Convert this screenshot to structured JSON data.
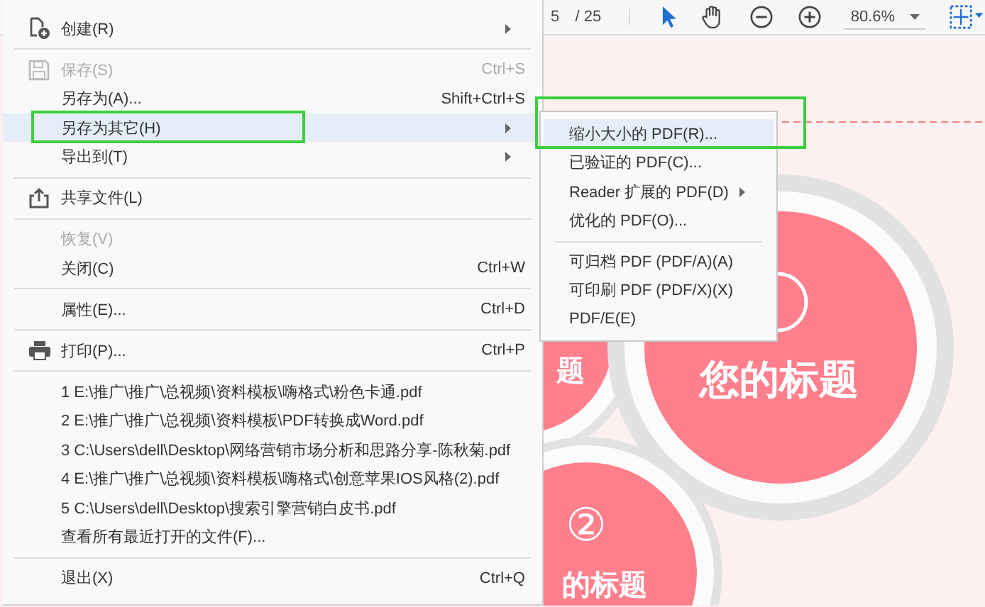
{
  "toolbar": {
    "page": "5",
    "page_count": "/ 25",
    "zoom": "80.6%"
  },
  "document": {
    "texts": [
      {
        "kind": "side_title",
        "text": "题"
      },
      {
        "kind": "main_title",
        "text": "您的标题"
      },
      {
        "kind": "number",
        "text": "②"
      },
      {
        "kind": "bottom_title",
        "text": "的标题"
      }
    ]
  },
  "menu": {
    "items": [
      {
        "kind": "item",
        "label": "创建(R)",
        "has_submenu": true,
        "disabled": false,
        "selected": false
      },
      {
        "kind": "separator"
      },
      {
        "kind": "item",
        "label": "保存(S)",
        "shortcut": "Ctrl+S",
        "has_submenu": false,
        "disabled": true,
        "selected": false
      },
      {
        "kind": "item",
        "label": "另存为(A)...",
        "shortcut": "Shift+Ctrl+S",
        "has_submenu": false,
        "disabled": false,
        "selected": false
      },
      {
        "kind": "item",
        "label": "另存为其它(H)",
        "has_submenu": true,
        "disabled": false,
        "selected": true
      },
      {
        "kind": "item",
        "label": "导出到(T)",
        "has_submenu": true,
        "disabled": false,
        "selected": false
      },
      {
        "kind": "separator"
      },
      {
        "kind": "item",
        "label": "共享文件(L)",
        "has_submenu": false,
        "disabled": false,
        "selected": false
      },
      {
        "kind": "separator"
      },
      {
        "kind": "item",
        "label": "恢复(V)",
        "has_submenu": false,
        "disabled": true,
        "selected": false
      },
      {
        "kind": "item",
        "label": "关闭(C)",
        "shortcut": "Ctrl+W",
        "has_submenu": false,
        "disabled": false,
        "selected": false
      },
      {
        "kind": "separator"
      },
      {
        "kind": "item",
        "label": "属性(E)...",
        "shortcut": "Ctrl+D",
        "has_submenu": false,
        "disabled": false,
        "selected": false
      },
      {
        "kind": "separator"
      },
      {
        "kind": "item",
        "label": "打印(P)...",
        "shortcut": "Ctrl+P",
        "has_submenu": false,
        "disabled": false,
        "selected": false
      },
      {
        "kind": "separator"
      },
      {
        "kind": "recent",
        "label": "1 E:\\推广\\推广\\总视频\\资料模板\\嗨格式\\粉色卡通.pdf",
        "selected": false
      },
      {
        "kind": "recent",
        "label": "2 E:\\推广\\推广\\总视频\\资料模板\\PDF转换成Word.pdf",
        "selected": false
      },
      {
        "kind": "recent",
        "label": "3 C:\\Users\\dell\\Desktop\\网络营销市场分析和思路分享-陈秋菊.pdf",
        "selected": false
      },
      {
        "kind": "recent",
        "label": "4 E:\\推广\\推广\\总视频\\资料模板\\嗨格式\\创意苹果IOS风格(2).pdf",
        "selected": false
      },
      {
        "kind": "recent",
        "label": "5 C:\\Users\\dell\\Desktop\\搜索引擎营销白皮书.pdf",
        "selected": false
      },
      {
        "kind": "recent",
        "label": "查看所有最近打开的文件(F)...",
        "selected": false
      },
      {
        "kind": "separator"
      },
      {
        "kind": "item",
        "label": "退出(X)",
        "shortcut": "Ctrl+Q",
        "has_submenu": false,
        "disabled": false,
        "selected": false
      }
    ]
  },
  "submenu": {
    "items": [
      {
        "kind": "item",
        "label": "缩小大小的 PDF(R)...",
        "has_submenu": false,
        "selected": true
      },
      {
        "kind": "item",
        "label": "已验证的 PDF(C)...",
        "has_submenu": false,
        "selected": false
      },
      {
        "kind": "item",
        "label": "Reader 扩展的 PDF(D)",
        "has_submenu": true,
        "selected": false
      },
      {
        "kind": "item",
        "label": "优化的 PDF(O)...",
        "has_submenu": false,
        "selected": false
      },
      {
        "kind": "separator"
      },
      {
        "kind": "item",
        "label": "可归档 PDF (PDF/A)(A)",
        "has_submenu": false,
        "selected": false
      },
      {
        "kind": "item",
        "label": "可印刷 PDF (PDF/X)(X)",
        "has_submenu": false,
        "selected": false
      },
      {
        "kind": "item",
        "label": "PDF/E(E)",
        "has_submenu": false,
        "selected": false
      }
    ]
  }
}
